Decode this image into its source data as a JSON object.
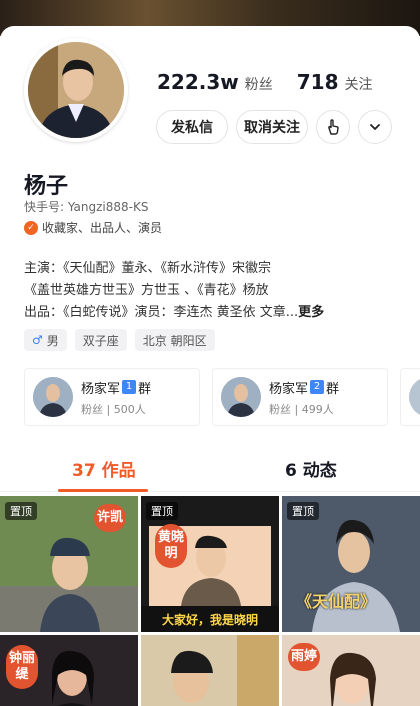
{
  "profile": {
    "followers_value": "222.3w",
    "followers_label": "粉丝",
    "following_value": "718",
    "following_label": "关注",
    "message_button": "发私信",
    "unfollow_button": "取消关注",
    "name": "杨子",
    "kuaishou_id": "快手号: Yangzi888-KS",
    "verification": "收藏家、出品人、演员",
    "bio_line1": "主演：《天仙配》董永、《新水浒传》宋徽宗",
    "bio_line2": "《盖世英雄方世玉》方世玉 、《青花》杨放",
    "bio_line3": "出品：《白蛇传说》演员：李连杰 黄圣依 文章...",
    "bio_more": "更多",
    "tags": [
      "男",
      "双子座",
      "北京 朝阳区"
    ]
  },
  "groups": [
    {
      "name": "杨家军",
      "num": "1",
      "suffix": "群",
      "sub": "粉丝 | 500人"
    },
    {
      "name": "杨家军",
      "num": "2",
      "suffix": "群",
      "sub": "粉丝 | 499人"
    }
  ],
  "tabs": {
    "works_count": "37",
    "works_label": "作品",
    "moments_count": "6",
    "moments_label": "动态"
  },
  "videos": [
    {
      "pinned": "置顶",
      "stamp": "许凯"
    },
    {
      "pinned": "置顶",
      "stamp": "黄晓明",
      "caption": "大家好，我是晓明"
    },
    {
      "pinned": "置顶",
      "watermark": "《天仙配》"
    },
    {
      "stamp": "钟丽缇"
    },
    {
      "stamp": ""
    },
    {
      "stamp": "雨婷"
    }
  ],
  "colors": {
    "accent": "#f25a28",
    "verify": "#f26422",
    "group_badge": "#3f86f7"
  }
}
